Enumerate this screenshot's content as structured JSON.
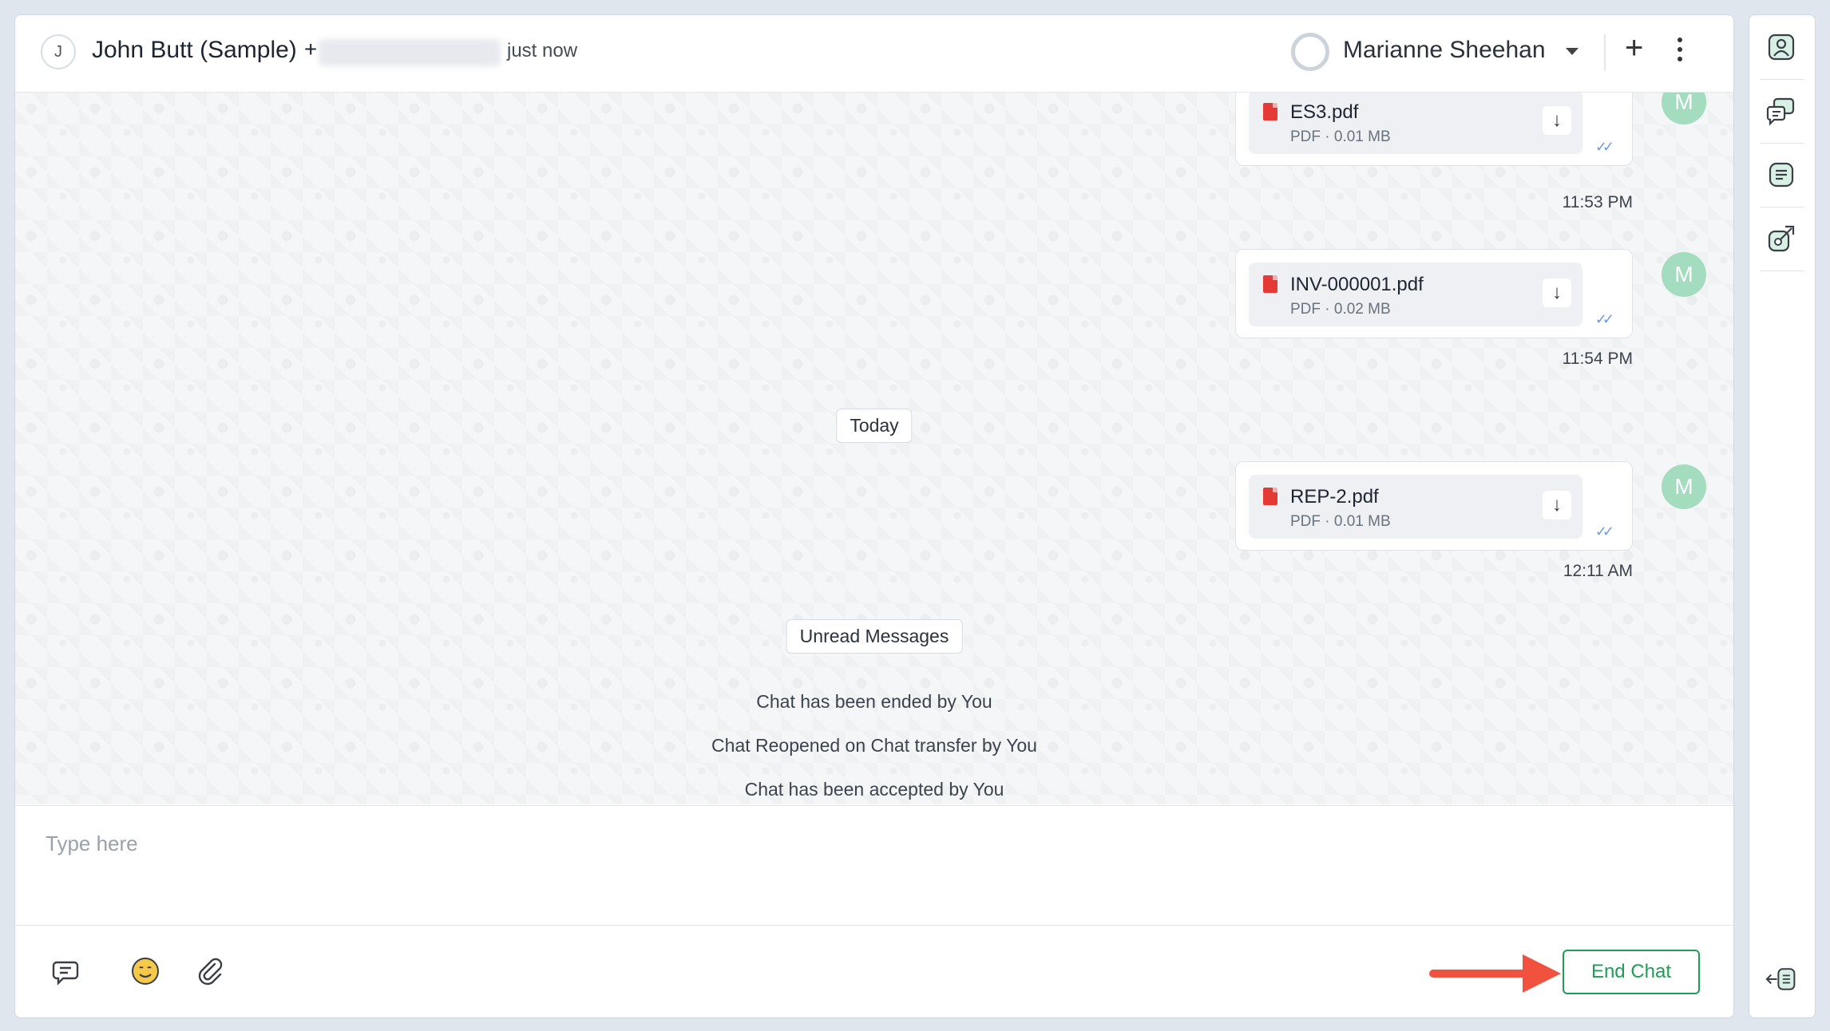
{
  "header": {
    "contact_initial": "J",
    "contact_name": "John Butt (Sample)",
    "phone_prefix": "+",
    "last_seen": "just now",
    "agent_name": "Marianne Sheehan",
    "add_label": "+"
  },
  "messages": [
    {
      "file_name": "ES3.pdf",
      "file_type": "PDF",
      "file_size": "0.01 MB",
      "time": "11:53 PM",
      "avatar": "M"
    },
    {
      "file_name": "INV-000001.pdf",
      "file_type": "PDF",
      "file_size": "0.02 MB",
      "time": "11:54 PM",
      "avatar": "M"
    },
    {
      "file_name": "REP-2.pdf",
      "file_type": "PDF",
      "file_size": "0.01 MB",
      "time": "12:11 AM",
      "avatar": "M"
    }
  ],
  "dividers": {
    "today": "Today",
    "unread": "Unread Messages"
  },
  "system_messages": [
    "Chat has been ended by You",
    "Chat Reopened on Chat transfer by You",
    "Chat has been accepted by You"
  ],
  "composer": {
    "placeholder": "Type here",
    "end_chat_label": "End Chat"
  },
  "icons": {
    "toolbar": [
      "canned-response-icon",
      "emoji-icon",
      "attachment-icon"
    ],
    "sidebar": [
      "contact-icon",
      "conversations-icon",
      "notes-icon",
      "tag-icon",
      "collapse-panel-icon"
    ]
  },
  "colors": {
    "accent_green": "#1f9d55",
    "avatar_green": "#a3dcbe",
    "pdf_red": "#e53935",
    "read_tick_blue": "#6f9be3",
    "annotation_arrow": "#f0523f"
  }
}
